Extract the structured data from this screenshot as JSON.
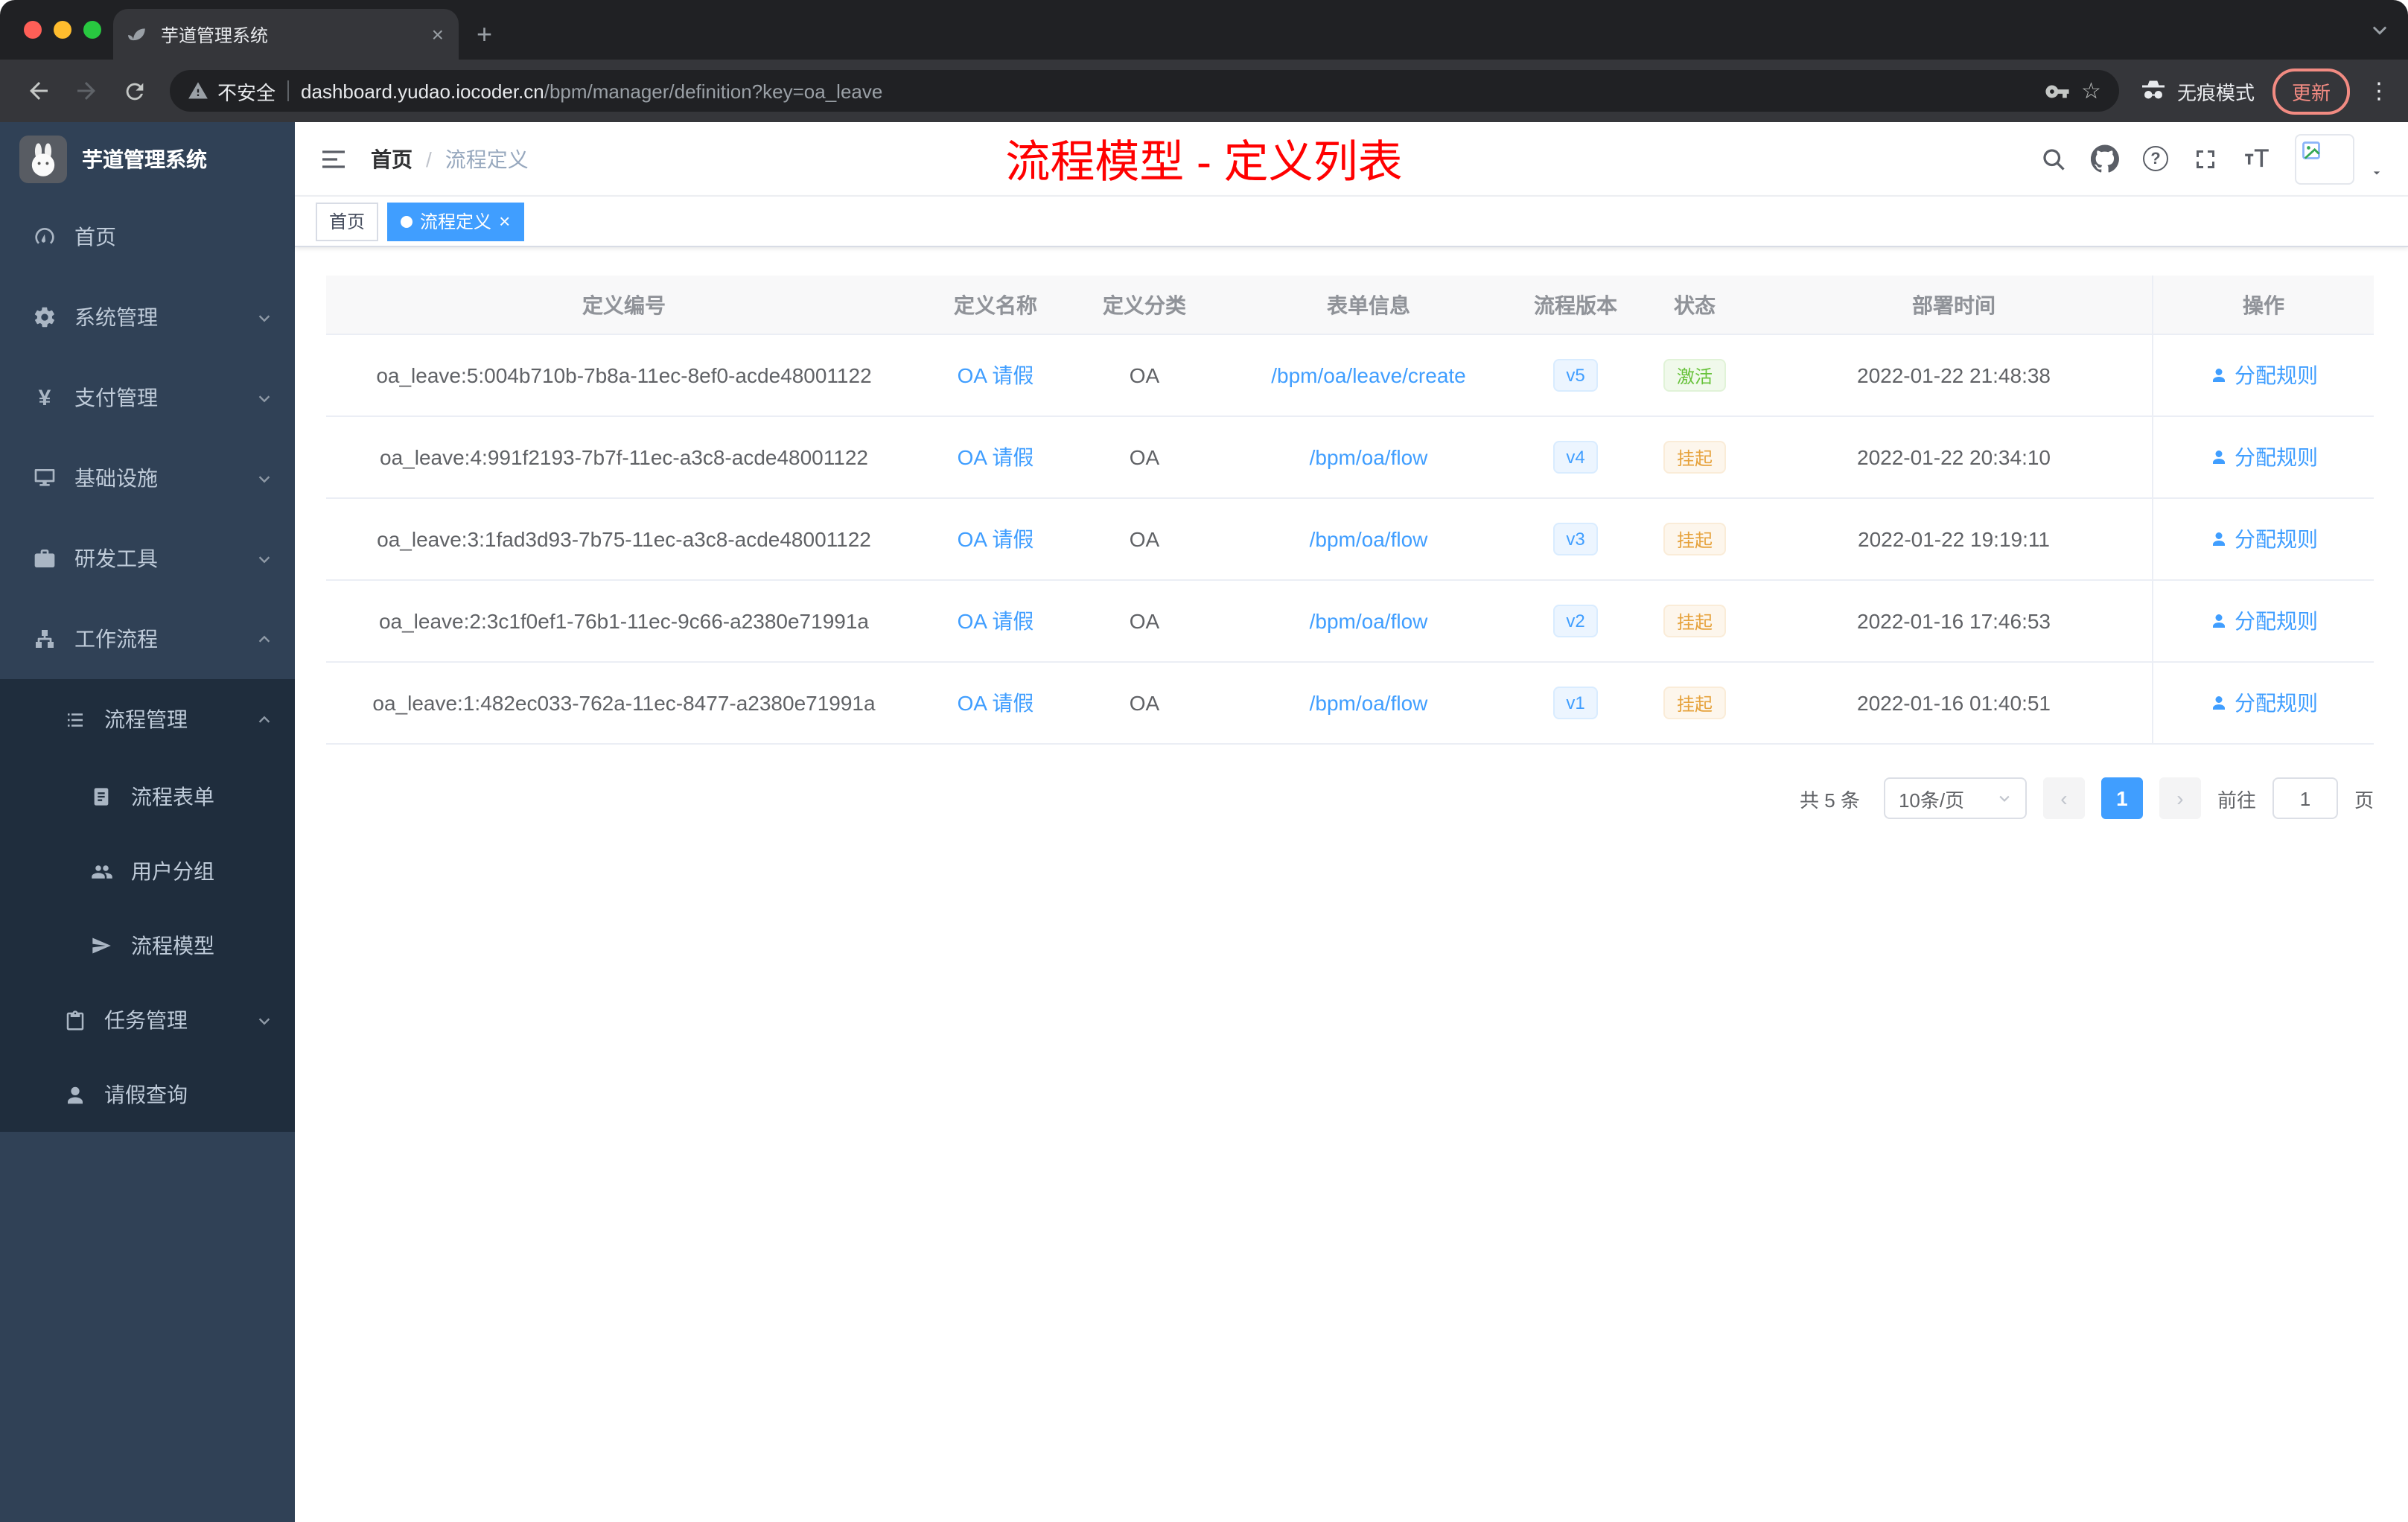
{
  "browser": {
    "tab_title": "芋道管理系统",
    "security_label": "不安全",
    "url_host": "dashboard.yudao.iocoder.cn",
    "url_path": "/bpm/manager/definition?key=oa_leave",
    "incognito_label": "无痕模式",
    "update_label": "更新"
  },
  "icons": {
    "close": "×",
    "plus": "+",
    "star": "☆",
    "kebab": "⋮",
    "question": "?",
    "yen": "¥",
    "prev": "‹",
    "next": "›"
  },
  "sidebar": {
    "brand": "芋道管理系统",
    "items": [
      {
        "label": "首页"
      },
      {
        "label": "系统管理"
      },
      {
        "label": "支付管理"
      },
      {
        "label": "基础设施"
      },
      {
        "label": "研发工具"
      },
      {
        "label": "工作流程"
      },
      {
        "label": "流程管理"
      },
      {
        "label": "流程表单"
      },
      {
        "label": "用户分组"
      },
      {
        "label": "流程模型"
      },
      {
        "label": "任务管理"
      },
      {
        "label": "请假查询"
      }
    ]
  },
  "header": {
    "breadcrumb_home": "首页",
    "breadcrumb_separator": "/",
    "breadcrumb_current": "流程定义",
    "annotation": "流程模型 - 定义列表"
  },
  "tags": {
    "home": "首页",
    "active": "流程定义"
  },
  "table": {
    "columns": [
      "定义编号",
      "定义名称",
      "定义分类",
      "表单信息",
      "流程版本",
      "状态",
      "部署时间",
      "操作"
    ],
    "rows": [
      {
        "id": "oa_leave:5:004b710b-7b8a-11ec-8ef0-acde48001122",
        "name": "OA 请假",
        "category": "OA",
        "form": "/bpm/oa/leave/create",
        "version": "v5",
        "status": "激活",
        "time": "2022-01-22 21:48:38",
        "action": "分配规则"
      },
      {
        "id": "oa_leave:4:991f2193-7b7f-11ec-a3c8-acde48001122",
        "name": "OA 请假",
        "category": "OA",
        "form": "/bpm/oa/flow",
        "version": "v4",
        "status": "挂起",
        "time": "2022-01-22 20:34:10",
        "action": "分配规则"
      },
      {
        "id": "oa_leave:3:1fad3d93-7b75-11ec-a3c8-acde48001122",
        "name": "OA 请假",
        "category": "OA",
        "form": "/bpm/oa/flow",
        "version": "v3",
        "status": "挂起",
        "time": "2022-01-22 19:19:11",
        "action": "分配规则"
      },
      {
        "id": "oa_leave:2:3c1f0ef1-76b1-11ec-9c66-a2380e71991a",
        "name": "OA 请假",
        "category": "OA",
        "form": "/bpm/oa/flow",
        "version": "v2",
        "status": "挂起",
        "time": "2022-01-16 17:46:53",
        "action": "分配规则"
      },
      {
        "id": "oa_leave:1:482ec033-762a-11ec-8477-a2380e71991a",
        "name": "OA 请假",
        "category": "OA",
        "form": "/bpm/oa/flow",
        "version": "v1",
        "status": "挂起",
        "time": "2022-01-16 01:40:51",
        "action": "分配规则"
      }
    ]
  },
  "pagination": {
    "total": "共 5 条",
    "page_size": "10条/页",
    "page": "1",
    "goto_label": "前往",
    "goto_value": "1",
    "unit_label": "页"
  },
  "colors": {
    "accent": "#409eff",
    "success": "#67c23a",
    "warning": "#e6a23c",
    "annotation": "#ff0000",
    "sidebar_bg": "#304156",
    "submenu_bg": "#1f2d3d"
  }
}
